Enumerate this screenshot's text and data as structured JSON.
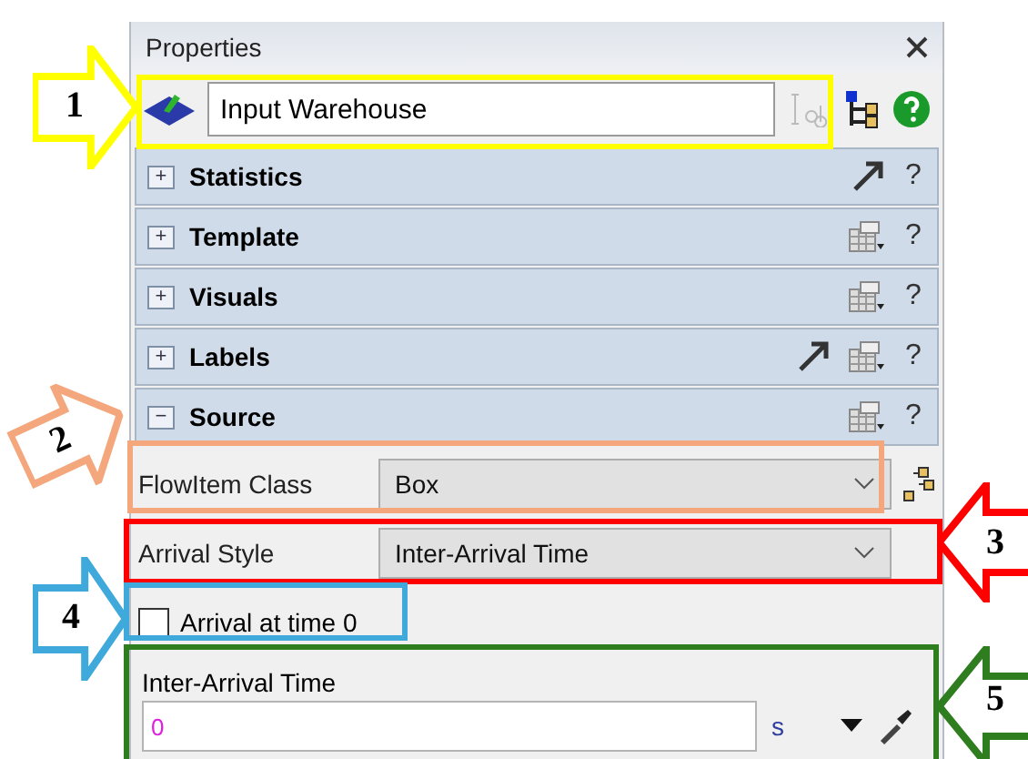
{
  "panel": {
    "title": "Properties",
    "object_name": "Input Warehouse"
  },
  "sections": [
    {
      "label": "Statistics",
      "toggle": "+",
      "arrow_icon": true,
      "template_icon": false,
      "help": "?"
    },
    {
      "label": "Template",
      "toggle": "+",
      "arrow_icon": false,
      "template_icon": true,
      "help": "?"
    },
    {
      "label": "Visuals",
      "toggle": "+",
      "arrow_icon": false,
      "template_icon": true,
      "help": "?"
    },
    {
      "label": "Labels",
      "toggle": "+",
      "arrow_icon": true,
      "template_icon": true,
      "help": "?"
    },
    {
      "label": "Source",
      "toggle": "−",
      "arrow_icon": false,
      "template_icon": true,
      "help": "?"
    }
  ],
  "source_fields": [
    {
      "kind": "dropdown",
      "label": "FlowItem Class",
      "value": "Box",
      "tree_button": true
    },
    {
      "kind": "dropdown",
      "label": "Arrival Style",
      "value": "Inter-Arrival Time",
      "tree_button": false
    },
    {
      "kind": "checkbox",
      "label": "Arrival at time 0",
      "checked": false
    },
    {
      "kind": "value",
      "label": "Inter-Arrival Time",
      "value": "0",
      "unit": "s"
    }
  ],
  "annotations": [
    {
      "number": "1",
      "color": "#ffff00"
    },
    {
      "number": "2",
      "color": "#f4a67c"
    },
    {
      "number": "3",
      "color": "#ff0000"
    },
    {
      "number": "4",
      "color": "#3fa9dc"
    },
    {
      "number": "5",
      "color": "#2e7d1e"
    }
  ]
}
